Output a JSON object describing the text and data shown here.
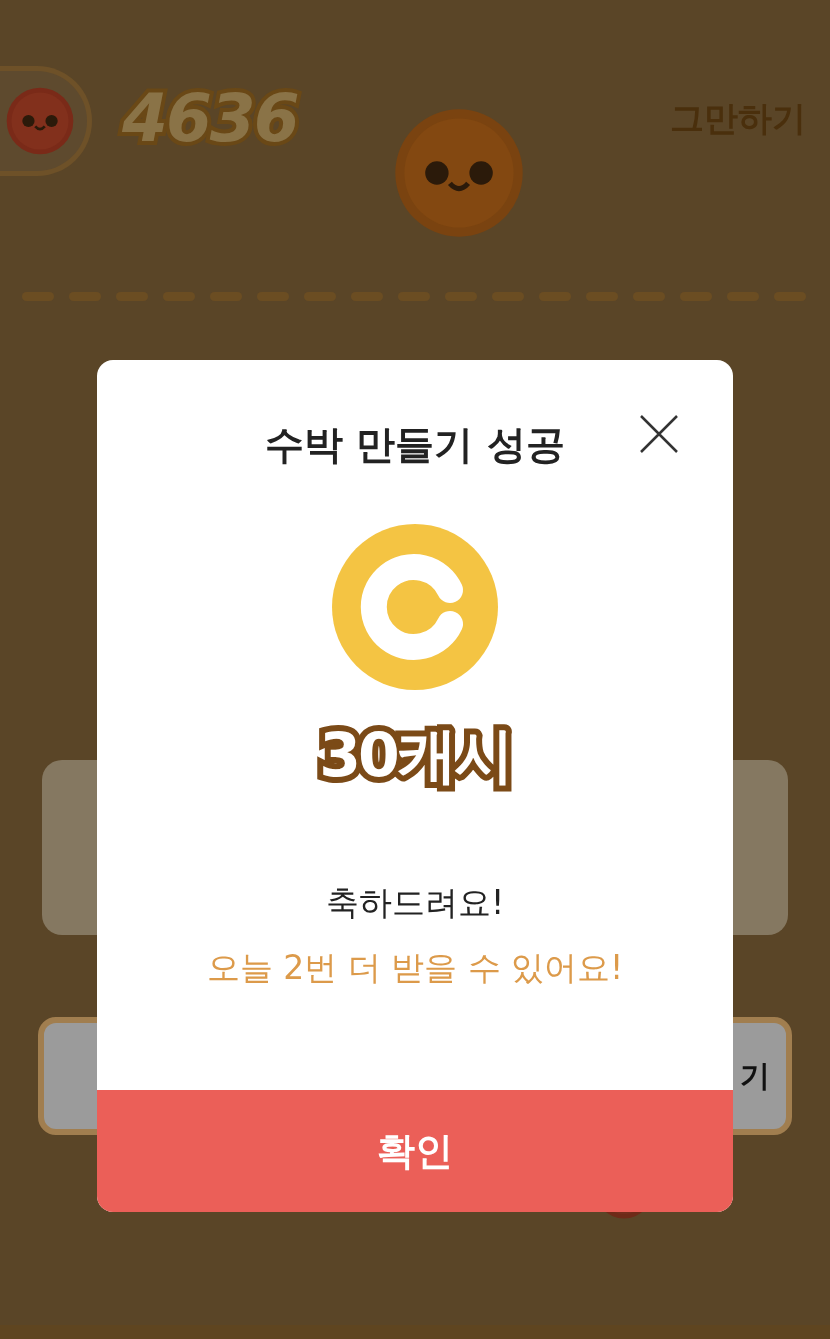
{
  "game": {
    "score": "4636",
    "quit_button": "그만하기",
    "action_button": "기"
  },
  "dialog": {
    "title": "수박 만들기 성공",
    "reward": "30캐시",
    "message": "축하드려요!",
    "note": "오늘 2번 더 받을 수 있어요!",
    "confirm_button": "확인"
  }
}
